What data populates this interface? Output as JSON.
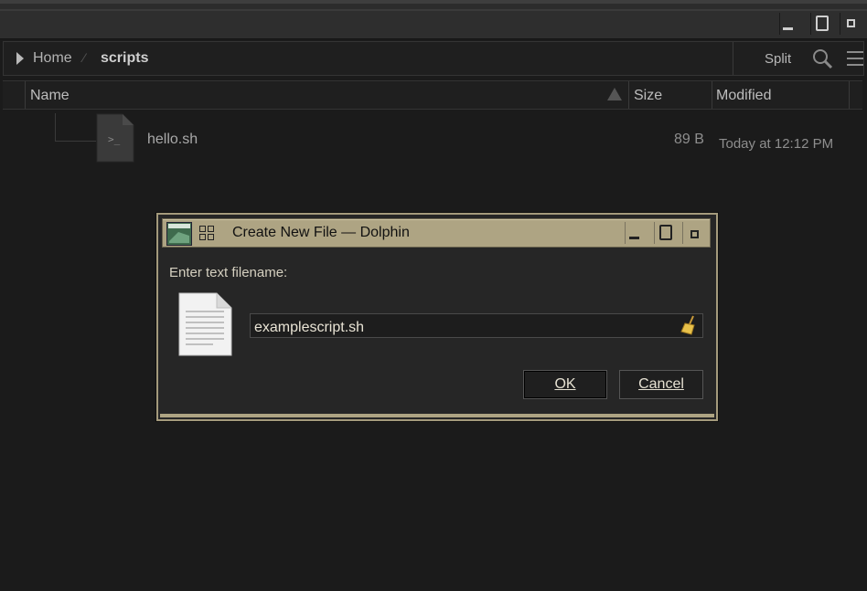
{
  "window": {
    "controls": [
      "minimize",
      "maximize",
      "close"
    ]
  },
  "toolbar": {
    "breadcrumb": [
      "Home",
      "scripts"
    ],
    "split_label": "Split",
    "search_icon": "magnifier-icon",
    "menu_icon": "hamburger-menu-icon"
  },
  "columns": {
    "name": "Name",
    "size": "Size",
    "modified": "Modified"
  },
  "files": [
    {
      "name": "hello.sh",
      "size": "89 B",
      "modified": "Today at 12:12 PM",
      "icon": "shell-script-icon"
    }
  ],
  "dialog": {
    "title": "Create New File — Dolphin",
    "prompt": "Enter text filename:",
    "input_value": "examplescript.sh",
    "ok_label": "OK",
    "cancel_label": "Cancel"
  }
}
